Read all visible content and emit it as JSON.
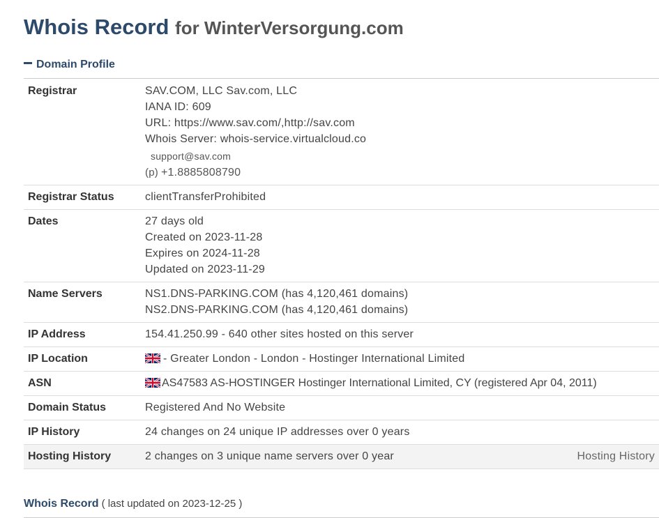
{
  "header": {
    "title_main": "Whois Record",
    "title_rest": "for WinterVersorgung.com"
  },
  "domain_profile": {
    "section_label": "Domain Profile",
    "rows": {
      "registrar": {
        "label": "Registrar",
        "name": "SAV.COM, LLC Sav.com, LLC",
        "iana": "IANA ID: 609",
        "url": "URL: https://www.sav.com/,http://sav.com",
        "whois_server": "Whois Server: whois-service.virtualcloud.co",
        "email": "support@sav.com",
        "phone_prefix": "(p)",
        "phone": "+1.8885808790"
      },
      "registrar_status": {
        "label": "Registrar Status",
        "value": "clientTransferProhibited"
      },
      "dates": {
        "label": "Dates",
        "age": "27 days old",
        "created": "Created on 2023-11-28",
        "expires": "Expires on 2024-11-28",
        "updated": "Updated on 2023-11-29"
      },
      "name_servers": {
        "label": "Name Servers",
        "ns1": "NS1.DNS-PARKING.COM (has 4,120,461 domains)",
        "ns2": "NS2.DNS-PARKING.COM (has 4,120,461 domains)"
      },
      "ip_address": {
        "label": "IP Address",
        "value": "154.41.250.99 - 640 other sites hosted on this server"
      },
      "ip_location": {
        "label": "IP Location",
        "value": "- Greater London - London - Hostinger International Limited"
      },
      "asn": {
        "label": "ASN",
        "value": "AS47583 AS-HOSTINGER Hostinger International Limited, CY (registered Apr 04, 2011)"
      },
      "domain_status": {
        "label": "Domain Status",
        "value": "Registered And No Website"
      },
      "ip_history": {
        "label": "IP History",
        "value": "24 changes on 24 unique IP addresses over 0 years"
      },
      "hosting_history": {
        "label": "Hosting History",
        "value": "2 changes on 3 unique name servers over 0 year",
        "link": "Hosting History"
      }
    }
  },
  "whois_record": {
    "label": "Whois Record",
    "updated": "( last updated on 2023-12-25 )"
  },
  "icons": {
    "flag": "uk-flag-icon",
    "collapse": "minus-icon"
  },
  "colors": {
    "title": "#2e4a6b",
    "shaded_row": "#f3f3f3"
  }
}
